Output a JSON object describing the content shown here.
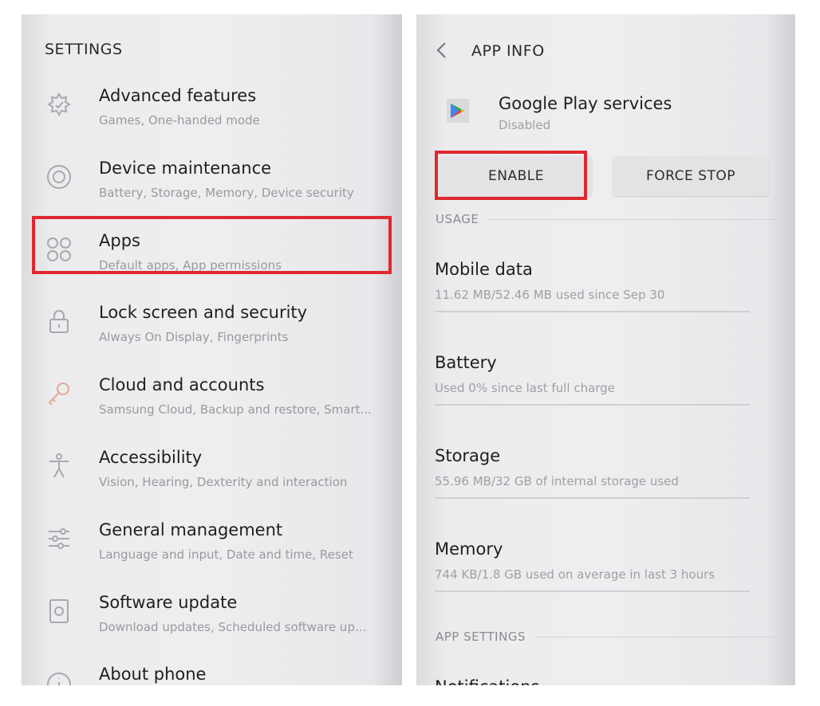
{
  "settings": {
    "title": "SETTINGS",
    "items": [
      {
        "title": "Advanced features",
        "subtitle": "Games, One-handed mode",
        "icon": "advanced-features-icon"
      },
      {
        "title": "Device maintenance",
        "subtitle": "Battery, Storage, Memory, Device security",
        "icon": "device-maintenance-icon"
      },
      {
        "title": "Apps",
        "subtitle": "Default apps, App permissions",
        "icon": "apps-icon"
      },
      {
        "title": "Lock screen and security",
        "subtitle": "Always On Display, Fingerprints",
        "icon": "lock-icon"
      },
      {
        "title": "Cloud and accounts",
        "subtitle": "Samsung Cloud, Backup and restore, Smart...",
        "icon": "key-icon"
      },
      {
        "title": "Accessibility",
        "subtitle": "Vision, Hearing, Dexterity and interaction",
        "icon": "accessibility-icon"
      },
      {
        "title": "General management",
        "subtitle": "Language and input, Date and time, Reset",
        "icon": "sliders-icon"
      },
      {
        "title": "Software update",
        "subtitle": "Download updates, Scheduled software up...",
        "icon": "software-update-icon"
      },
      {
        "title": "About phone",
        "subtitle": "",
        "icon": "info-icon"
      }
    ],
    "highlighted_item": "Apps"
  },
  "app_info": {
    "title": "APP INFO",
    "app_name": "Google Play services",
    "app_status": "Disabled",
    "enable_label": "ENABLE",
    "force_stop_label": "FORCE STOP",
    "usage_header": "USAGE",
    "rows": [
      {
        "title": "Mobile data",
        "subtitle": "11.62 MB/52.46 MB used since Sep 30"
      },
      {
        "title": "Battery",
        "subtitle": "Used 0% since last full charge"
      },
      {
        "title": "Storage",
        "subtitle": "55.96 MB/32 GB of internal storage used"
      },
      {
        "title": "Memory",
        "subtitle": "744 KB/1.8 GB used on average in last 3 hours"
      }
    ],
    "app_settings_header": "APP SETTINGS",
    "cut_off_row": "Notifications"
  },
  "colors": {
    "highlight": "#e0272f",
    "accent": "#3e74c8"
  }
}
